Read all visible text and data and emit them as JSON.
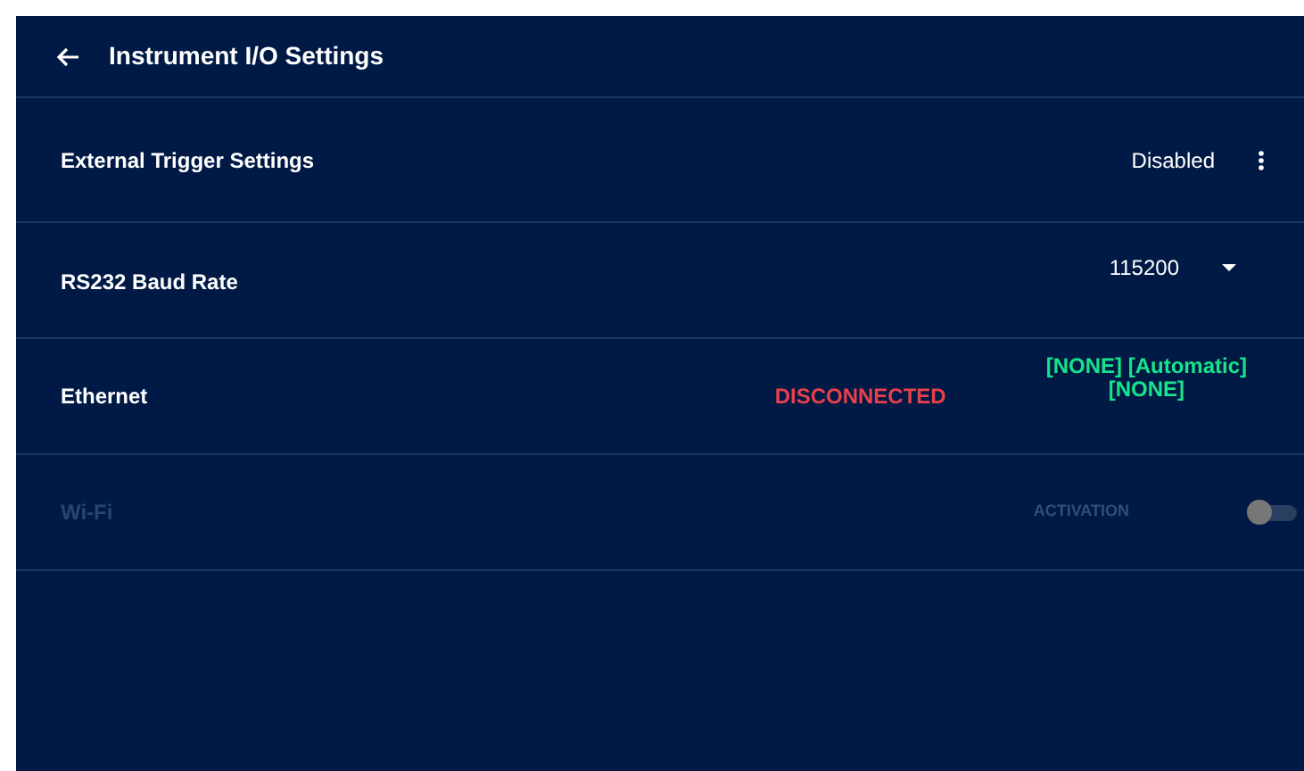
{
  "header": {
    "title": "Instrument I/O Settings"
  },
  "settings": [
    {
      "kind": "menu",
      "label": "External Trigger Settings",
      "value": "Disabled",
      "disabled": false
    },
    {
      "kind": "dropdown",
      "label": "RS232 Baud Rate",
      "value": "115200",
      "disabled": false
    },
    {
      "kind": "status",
      "label": "Ethernet",
      "status": "DISCONNECTED",
      "connected": false,
      "detail": [
        "[NONE] [Automatic]",
        "[NONE]"
      ],
      "disabled": false
    },
    {
      "kind": "toggle",
      "label": "Wi-Fi",
      "toggle_label": "ACTIVATION",
      "on": false,
      "disabled": true
    }
  ]
}
